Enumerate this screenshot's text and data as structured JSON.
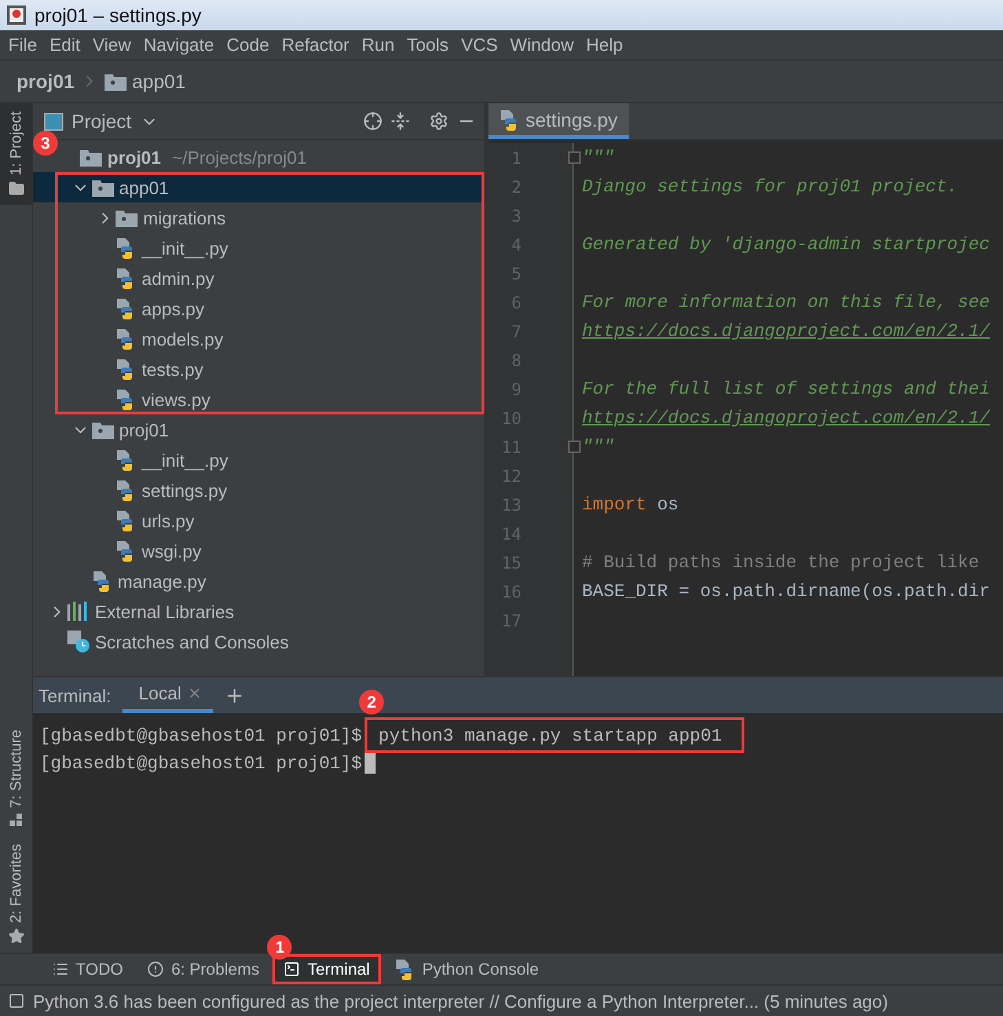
{
  "window": {
    "title": "proj01 – settings.py"
  },
  "menu": [
    "File",
    "Edit",
    "View",
    "Navigate",
    "Code",
    "Refactor",
    "Run",
    "Tools",
    "VCS",
    "Window",
    "Help"
  ],
  "breadcrumb": [
    "proj01",
    "app01"
  ],
  "left_stripe": {
    "top": [
      {
        "label": "1: Project",
        "selected": true
      }
    ],
    "bottom": [
      {
        "label": "7: Structure",
        "kind": "structure",
        "selected": false
      },
      {
        "label": "2: Favorites",
        "kind": "favorites",
        "selected": false
      }
    ]
  },
  "project_panel": {
    "title": "Project",
    "tree": [
      {
        "name": "proj01",
        "path": "~/Projects/proj01",
        "kind": "root",
        "selected": false,
        "annotation": {
          "badge": "3"
        },
        "children": [
          {
            "name": "app01",
            "kind": "package",
            "expanded": true,
            "selected": true,
            "annotated": true,
            "children": [
              {
                "name": "migrations",
                "kind": "package",
                "expanded": false,
                "selected": false
              },
              {
                "name": "__init__.py",
                "kind": "python",
                "selected": false
              },
              {
                "name": "admin.py",
                "kind": "python",
                "selected": false
              },
              {
                "name": "apps.py",
                "kind": "python",
                "selected": false
              },
              {
                "name": "models.py",
                "kind": "python",
                "selected": false
              },
              {
                "name": "tests.py",
                "kind": "python",
                "selected": false
              },
              {
                "name": "views.py",
                "kind": "python",
                "selected": false
              }
            ]
          },
          {
            "name": "proj01",
            "kind": "package",
            "expanded": true,
            "selected": false,
            "children": [
              {
                "name": "__init__.py",
                "kind": "python",
                "selected": false
              },
              {
                "name": "settings.py",
                "kind": "python",
                "selected": false
              },
              {
                "name": "urls.py",
                "kind": "python",
                "selected": false
              },
              {
                "name": "wsgi.py",
                "kind": "python",
                "selected": false
              }
            ]
          },
          {
            "name": "manage.py",
            "kind": "python",
            "selected": false
          }
        ]
      },
      {
        "name": "External Libraries",
        "kind": "library",
        "expanded": false,
        "selected": false
      },
      {
        "name": "Scratches and Consoles",
        "kind": "scratches",
        "selected": false
      }
    ]
  },
  "editor": {
    "tabs": [
      {
        "label": "settings.py",
        "selected": true
      }
    ],
    "lines": [
      {
        "number": "1",
        "fold": true,
        "segments": [
          {
            "kind": "doc",
            "text": "\"\"\""
          }
        ]
      },
      {
        "number": "2",
        "segments": [
          {
            "kind": "doc",
            "text": "Django settings for proj01 project."
          }
        ]
      },
      {
        "number": "3"
      },
      {
        "number": "4",
        "segments": [
          {
            "kind": "doc",
            "text": "Generated by 'django-admin startprojec"
          }
        ]
      },
      {
        "number": "5"
      },
      {
        "number": "6",
        "segments": [
          {
            "kind": "doc",
            "text": "For more information on this file, see"
          }
        ]
      },
      {
        "number": "7",
        "segments": [
          {
            "kind": "link",
            "text": "https://docs.djangoproject.com/en/2.1/"
          }
        ]
      },
      {
        "number": "8"
      },
      {
        "number": "9",
        "segments": [
          {
            "kind": "doc",
            "text": "For the full list of settings and thei"
          }
        ]
      },
      {
        "number": "10",
        "segments": [
          {
            "kind": "link",
            "text": "https://docs.djangoproject.com/en/2.1/"
          }
        ]
      },
      {
        "number": "11",
        "fold": true,
        "segments": [
          {
            "kind": "doc",
            "text": "\"\"\""
          }
        ]
      },
      {
        "number": "12"
      },
      {
        "number": "13",
        "segments": [
          {
            "kind": "keyword",
            "text": "import"
          },
          {
            "kind": "plain",
            "text": " os"
          }
        ]
      },
      {
        "number": "14"
      },
      {
        "number": "15",
        "segments": [
          {
            "kind": "comment",
            "text": "# Build paths inside the project like"
          }
        ]
      },
      {
        "number": "16",
        "segments": [
          {
            "kind": "plain",
            "text": "BASE_DIR = os.path.dirname(os.path.dir"
          }
        ]
      },
      {
        "number": "17"
      }
    ]
  },
  "terminal": {
    "title": "Terminal:",
    "tabs": [
      {
        "label": "Local",
        "selected": true
      }
    ],
    "lines": [
      {
        "prompt": "[gbasedbt@gbasehost01 proj01]$",
        "command": "python3 manage.py startapp app01",
        "annotation": {
          "badge": "2"
        }
      },
      {
        "prompt": "[gbasedbt@gbasehost01 proj01]$",
        "cursor": true
      }
    ]
  },
  "tool_tabs": [
    {
      "label": "TODO",
      "kind": "todo",
      "selected": false
    },
    {
      "label": "6: Problems",
      "kind": "problems",
      "selected": false
    },
    {
      "label": "Terminal",
      "kind": "terminal",
      "selected": true,
      "annotation": {
        "badge": "1"
      }
    },
    {
      "label": "Python Console",
      "kind": "console",
      "selected": false
    }
  ],
  "status_bar": "Python 3.6 has been configured as the project interpreter // Configure a Python Interpreter... (5 minutes ago)"
}
